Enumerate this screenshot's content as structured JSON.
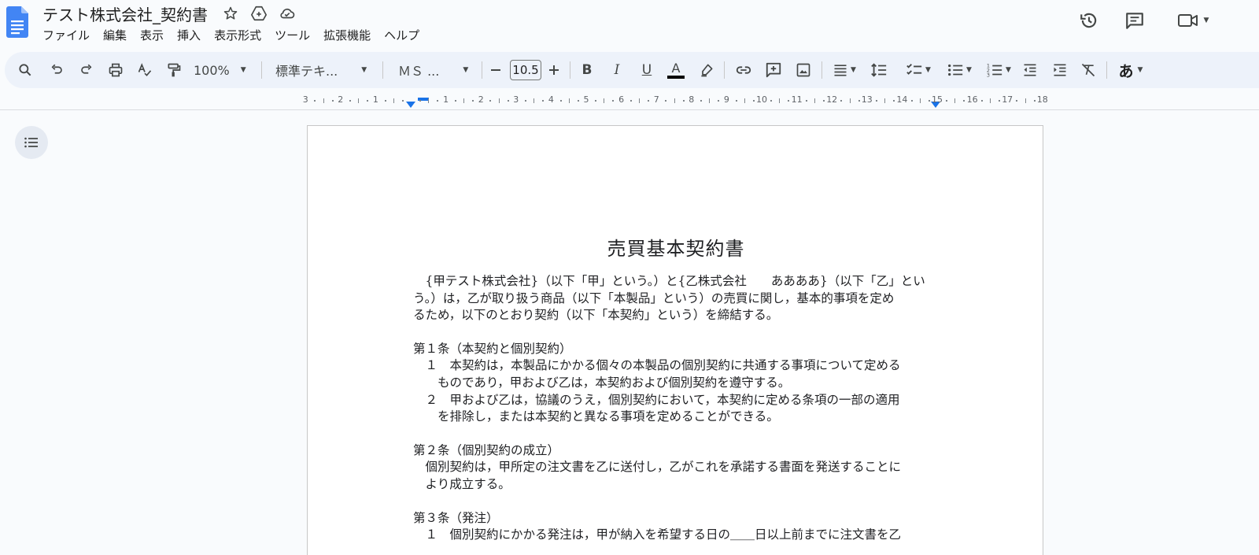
{
  "header": {
    "title": "テスト株式会社_契約書",
    "menu": [
      "ファイル",
      "編集",
      "表示",
      "挿入",
      "表示形式",
      "ツール",
      "拡張機能",
      "ヘルプ"
    ]
  },
  "toolbar": {
    "zoom": "100%",
    "style": "標準テキ...",
    "font": "ＭＳ ...",
    "font_size": "10.5",
    "input_tool": "あ",
    "bold": "B",
    "italic": "I",
    "underline": "U",
    "text_color": "A"
  },
  "ruler": {
    "left_labels": [
      "3",
      "2",
      "1"
    ],
    "right_labels": [
      "1",
      "2",
      "3",
      "4",
      "5",
      "6",
      "7",
      "8",
      "9",
      "10",
      "11",
      "12",
      "13",
      "14",
      "15",
      "16",
      "17",
      "18"
    ]
  },
  "document": {
    "heading": "売買基本契約書",
    "lines": [
      "　{甲テスト株式会社}（以下「甲」という。）と{乙株式会社　　ああああ}（以下「乙」とい",
      "う。）は，乙が取り扱う商品（以下「本製品」という）の売買に関し，基本的事項を定め",
      "るため，以下のとおり契約（以下「本契約」という）を締結する。",
      "",
      "第１条（本契約と個別契約）",
      "　１　本契約は，本製品にかかる個々の本製品の個別契約に共通する事項について定める",
      "　　ものであり，甲および乙は，本契約および個別契約を遵守する。",
      "　２　甲および乙は，協議のうえ，個別契約において，本契約に定める条項の一部の適用",
      "　　を排除し，または本契約と異なる事項を定めることができる。",
      "",
      "第２条（個別契約の成立）",
      "　個別契約は，甲所定の注文書を乙に送付し，乙がこれを承諾する書面を発送することに",
      "　より成立する。",
      "",
      "第３条（発注）",
      "　１　個別契約にかかる発注は，甲が納入を希望する日の＿＿日以上前までに注文書を乙"
    ]
  },
  "colors": {
    "accent": "#1a73e8",
    "toolbar_bg": "#edf2fa",
    "page_bg": "#f9fbfd"
  }
}
